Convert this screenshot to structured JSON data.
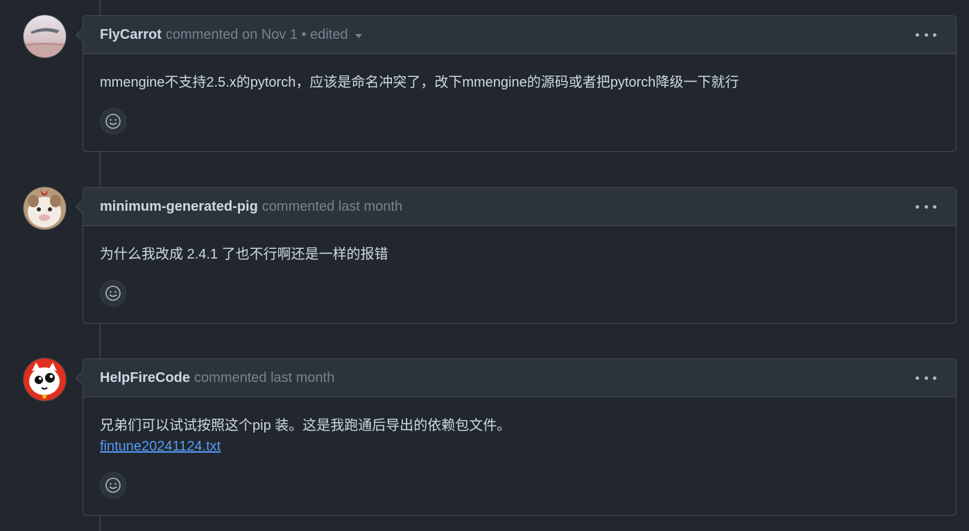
{
  "comments": [
    {
      "author": "FlyCarrot",
      "meta": "commented on Nov 1 • edited",
      "body": "mmengine不支持2.5.x的pytorch，应该是命名冲突了，改下mmengine的源码或者把pytorch降级一下就行",
      "link": null,
      "edited": true
    },
    {
      "author": "minimum-generated-pig",
      "meta": "commented last month",
      "body": "为什么我改成 2.4.1 了也不行啊还是一样的报错",
      "link": null,
      "edited": false
    },
    {
      "author": "HelpFireCode",
      "meta": "commented last month",
      "body": "兄弟们可以试试按照这个pip 装。这是我跑通后导出的依赖包文件。",
      "link": "fintune20241124.txt",
      "edited": false
    }
  ],
  "icons": {
    "more": "kebab-horizontal-icon",
    "reaction": "smiley-icon",
    "edited_dropdown": "triangle-down-icon"
  },
  "colors": {
    "background": "#22272e",
    "header": "#2d333b",
    "border": "#444c56",
    "link": "#539bf5",
    "muted": "#768390",
    "text": "#cdd9e5"
  }
}
